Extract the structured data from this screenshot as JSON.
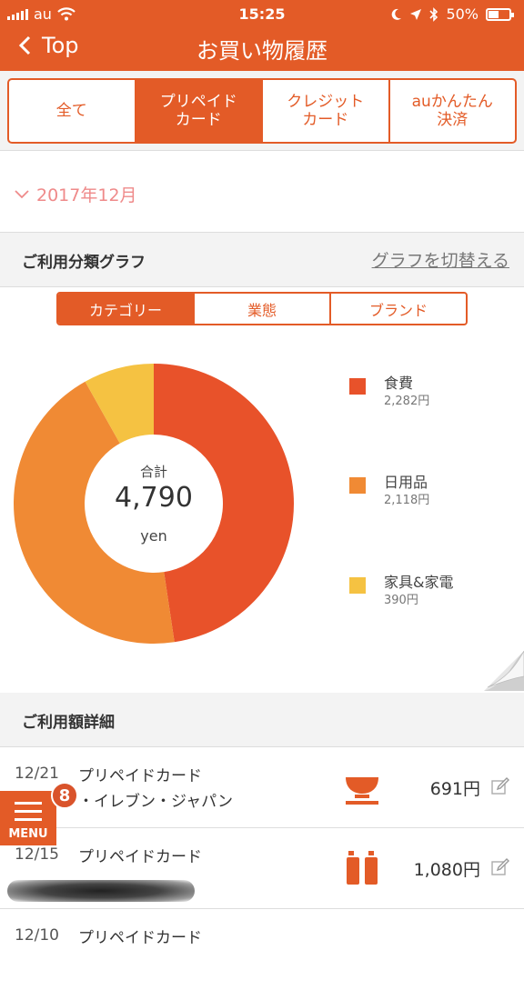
{
  "status_bar": {
    "carrier": "au",
    "time": "15:25",
    "battery_percent": "50%",
    "battery_level": 0.5
  },
  "nav": {
    "back_label": "Top",
    "title": "お買い物履歴"
  },
  "tabs": [
    {
      "label": "全て",
      "active": false
    },
    {
      "label": "プリペイド\nカード",
      "active": true
    },
    {
      "label": "クレジット\nカード",
      "active": false
    },
    {
      "label": "auかんたん\n決済",
      "active": false
    }
  ],
  "month": {
    "label": "2017年12月"
  },
  "graph_section": {
    "title": "ご利用分類グラフ",
    "switch_link": "グラフを切替える",
    "tabs": [
      {
        "label": "カテゴリー",
        "active": true
      },
      {
        "label": "業態",
        "active": false
      },
      {
        "label": "ブランド",
        "active": false
      }
    ]
  },
  "chart_data": {
    "type": "pie",
    "style": "donut",
    "total_label": "合計",
    "total": "4,790",
    "unit": "yen",
    "slices": [
      {
        "name": "食費",
        "value": 2282,
        "value_label": "2,282円",
        "color": "#e8522a"
      },
      {
        "name": "日用品",
        "value": 2118,
        "value_label": "2,118円",
        "color": "#f08a34"
      },
      {
        "name": "家具&家電",
        "value": 390,
        "value_label": "390円",
        "color": "#f5c242"
      }
    ]
  },
  "detail_section": {
    "title": "ご利用額詳細"
  },
  "transactions": [
    {
      "date": "12/21",
      "merchant": "プリペイドカード",
      "sub": "・イレブン・ジャパン",
      "amount": "691円",
      "category_icon": "rice-bowl-icon"
    },
    {
      "date": "12/15",
      "merchant": "プリペイドカード",
      "sub": "",
      "amount": "1,080円",
      "category_icon": "bottles-icon"
    },
    {
      "date": "12/10",
      "merchant": "プリペイドカード",
      "sub": "",
      "amount": "",
      "category_icon": ""
    }
  ],
  "menu": {
    "label": "MENU",
    "badge": "8"
  },
  "colors": {
    "accent": "#e35b27",
    "month_text": "#ef8a8a"
  }
}
